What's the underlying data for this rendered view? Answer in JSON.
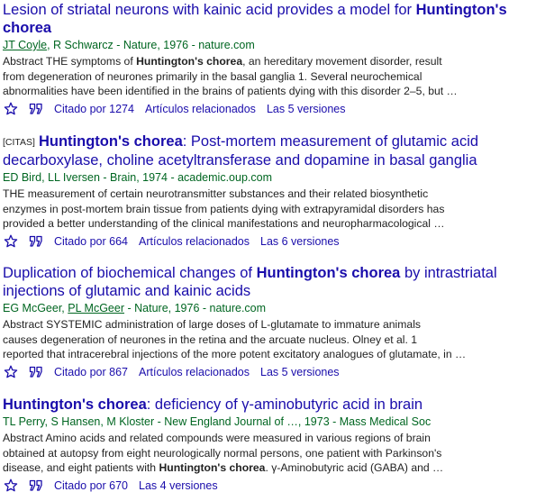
{
  "results": [
    {
      "tag": "",
      "title_line1_pre": "Lesion of striatal neurons with kainic acid provides a model for ",
      "title_line1_bold": "Huntington's",
      "title_line2_bold": "chorea",
      "title_line2_post": "",
      "authors": [
        {
          "name": "JT Coyle",
          "linked": true
        },
        {
          "name": "R Schwarcz",
          "linked": false
        }
      ],
      "source": " - Nature, 1976 - nature.com",
      "snippet_lines": [
        [
          "Abstract THE symptoms of ",
          "Huntington's chorea",
          ", an hereditary movement disorder, result"
        ],
        [
          "from degeneration of neurones primarily in the basal ganglia 1. Several neurochemical",
          "",
          ""
        ],
        [
          "abnormalities have been identified in the brains of patients dying with this disorder 2–5, but …",
          "",
          ""
        ]
      ],
      "cited": "Citado por 1274",
      "related": "Artículos relacionados",
      "versions": "Las 5 versiones"
    },
    {
      "tag": "[CITAS]",
      "title_line1_pre": "",
      "title_line1_bold": "Huntington's chorea",
      "title_line1_post": ": Post-mortem measurement of glutamic acid",
      "title_line2": "decarboxylase, choline acetyltransferase and dopamine in basal ganglia",
      "authors_text": "ED Bird, LL Iversen",
      "source": " - Brain, 1974 - academic.oup.com",
      "snippet_lines": [
        "THE measurement of certain neurotransmitter substances and their related biosynthetic",
        "enzymes in post-mortem brain tissue from patients dying with extrapyramidal disorders has",
        "provided a better understanding of the clinical manifestations and neuropharmacological …"
      ],
      "cited": "Citado por 664",
      "related": "Artículos relacionados",
      "versions": "Las 6 versiones"
    },
    {
      "title_line1_pre": "Duplication of biochemical changes of ",
      "title_line1_bold": "Huntington's chorea",
      "title_line1_post": " by intrastriatal",
      "title_line2": "injections of glutamic and kainic acids",
      "authors": [
        {
          "name": "EG McGeer",
          "linked": false
        },
        {
          "name": "PL McGeer",
          "linked": true
        }
      ],
      "source": " - Nature, 1976 - nature.com",
      "snippet_lines": [
        "Abstract SYSTEMIC administration of large doses of L-glutamate to immature animals",
        "causes degeneration of neurones in the retina and the arcuate nucleus. Olney et al. 1",
        "reported that intracerebral injections of the more potent excitatory analogues of glutamate, in …"
      ],
      "cited": "Citado por 867",
      "related": "Artículos relacionados",
      "versions": "Las 5 versiones"
    },
    {
      "title_bold": "Huntington's chorea",
      "title_post": ": deficiency of γ-aminobutyric acid in brain",
      "authors_text": "TL Perry, S Hansen, M Kloster",
      "source": " - New England Journal of …, 1973 - Mass Medical Soc",
      "snippet_lines": [
        [
          "Abstract Amino acids and related compounds were measured in various regions of brain",
          "",
          ""
        ],
        [
          "obtained at autopsy from eight neurologically normal persons, one patient with Parkinson's",
          "",
          ""
        ],
        [
          "disease, and eight patients with ",
          "Huntington's chorea",
          ". γ-Aminobutyric acid (GABA) and …"
        ]
      ],
      "cited": "Citado por 670",
      "versions": "Las 4 versiones"
    }
  ],
  "colors": {
    "link": "#1a0dab",
    "green": "#006621",
    "text": "#222222"
  },
  "icons": {
    "star": "star-icon",
    "quote": "quote-icon"
  }
}
